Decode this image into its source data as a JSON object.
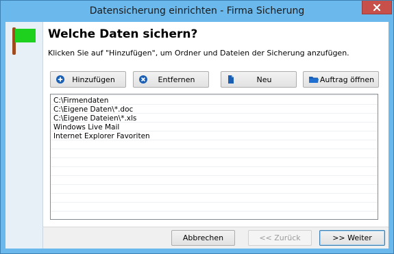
{
  "window": {
    "title": "Datensicherung einrichten - Firma Sicherung"
  },
  "header": {
    "heading": "Welche Daten sichern?",
    "instruction": "Klicken Sie auf \"Hinzufügen\", um Ordner und Dateien der Sicherung anzufügen."
  },
  "toolbar": {
    "add_label": "Hinzufügen",
    "remove_label": "Entfernen",
    "new_label": "Neu",
    "open_job_label": "Auftrag öffnen"
  },
  "list": {
    "items": [
      "C:\\Firmendaten",
      "C:\\Eigene Daten\\*.doc",
      "C:\\Eigene Dateien\\*.xls",
      "Windows Live Mail",
      "Internet Explorer Favoriten"
    ]
  },
  "footer": {
    "cancel_label": "Abbrechen",
    "back_label": "<< Zurück",
    "next_label": ">> Weiter"
  },
  "colors": {
    "titlebar": "#6ab8ec",
    "close": "#c7504a",
    "flag_green": "#1fd11f",
    "flag_pole": "#a04a20",
    "icon_blue": "#1a5fb4"
  },
  "icons": {
    "flag": "green-flag-icon",
    "add": "plus-circle-icon",
    "remove": "x-circle-icon",
    "new": "new-document-icon",
    "open": "folder-icon",
    "close": "close-icon"
  }
}
